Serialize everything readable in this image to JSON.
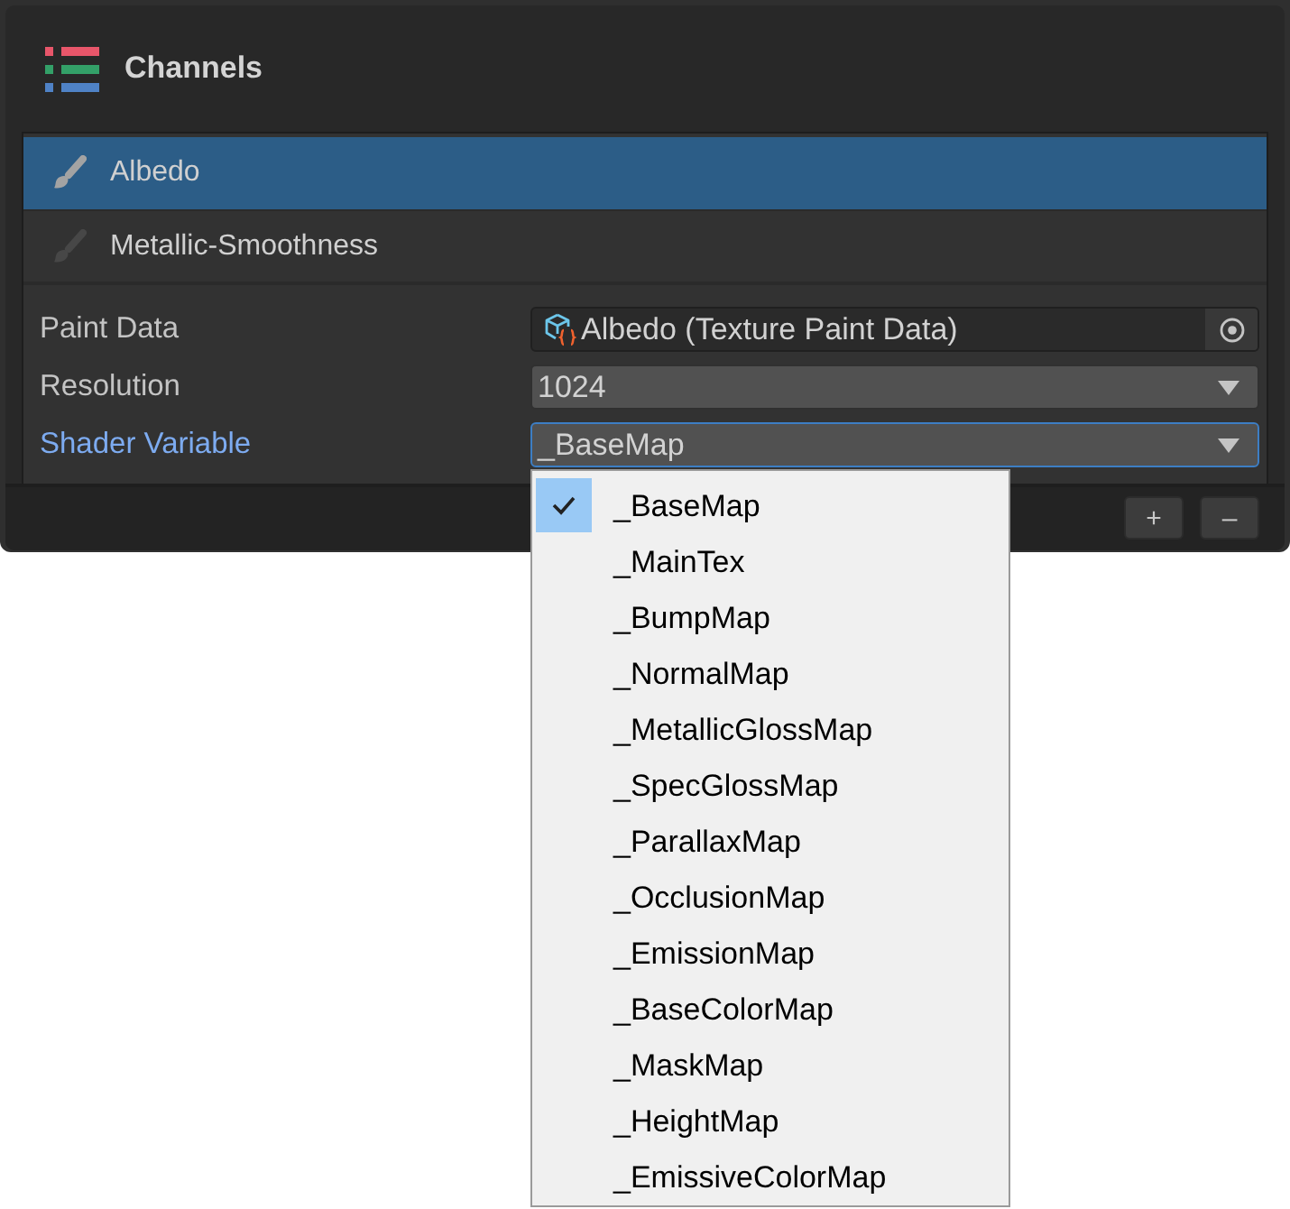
{
  "panel": {
    "title": "Channels"
  },
  "channels": [
    {
      "label": "Albedo",
      "selected": true
    },
    {
      "label": "Metallic-Smoothness",
      "selected": false
    }
  ],
  "properties": [
    {
      "kind": "object",
      "label": "Paint Data",
      "value": "Albedo (Texture Paint Data)",
      "focused": false
    },
    {
      "kind": "dropdown",
      "label": "Resolution",
      "value": "1024",
      "focused": false
    },
    {
      "kind": "dropdown",
      "label": "Shader Variable",
      "value": "_BaseMap",
      "focused": true
    }
  ],
  "footer_buttons": [
    "+",
    "–"
  ],
  "dropdown_menu": {
    "items": [
      {
        "label": "_BaseMap",
        "selected": true
      },
      {
        "label": "_MainTex",
        "selected": false
      },
      {
        "label": "_BumpMap",
        "selected": false
      },
      {
        "label": "_NormalMap",
        "selected": false
      },
      {
        "label": "_MetallicGlossMap",
        "selected": false
      },
      {
        "label": "_SpecGlossMap",
        "selected": false
      },
      {
        "label": "_ParallaxMap",
        "selected": false
      },
      {
        "label": "_OcclusionMap",
        "selected": false
      },
      {
        "label": "_EmissionMap",
        "selected": false
      },
      {
        "label": "_BaseColorMap",
        "selected": false
      },
      {
        "label": "_MaskMap",
        "selected": false
      },
      {
        "label": "_HeightMap",
        "selected": false
      },
      {
        "label": "_EmissiveColorMap",
        "selected": false
      }
    ]
  }
}
